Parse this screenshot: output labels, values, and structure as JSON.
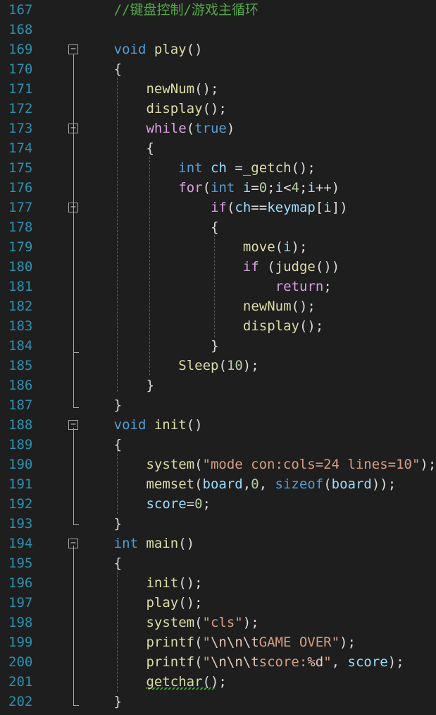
{
  "editor": {
    "language": "C",
    "colors": {
      "background": "#1e1e1e",
      "line_number": "#2b91af",
      "keyword": "#569cd6",
      "control": "#d8a0df",
      "function": "#dcdcaa",
      "variable": "#9cdcfe",
      "number": "#b5cea8",
      "string": "#d69d85",
      "escape": "#e8c9bb",
      "comment": "#57a64a",
      "text": "#dcdcdc"
    },
    "folding_icon": "minus-box-icon",
    "lines": [
      {
        "num": "167",
        "code": "        //键盘控制/游戏主循环"
      },
      {
        "num": "168",
        "code": ""
      },
      {
        "num": "169",
        "code": "        void play()"
      },
      {
        "num": "170",
        "code": "        {"
      },
      {
        "num": "171",
        "code": "            newNum();"
      },
      {
        "num": "172",
        "code": "            display();"
      },
      {
        "num": "173",
        "code": "            while(true)"
      },
      {
        "num": "174",
        "code": "            {"
      },
      {
        "num": "175",
        "code": "                int ch =_getch();"
      },
      {
        "num": "176",
        "code": "                for(int i=0;i<4;i++)"
      },
      {
        "num": "177",
        "code": "                    if(ch==keymap[i])"
      },
      {
        "num": "178",
        "code": "                    {"
      },
      {
        "num": "179",
        "code": "                        move(i);"
      },
      {
        "num": "180",
        "code": "                        if (judge())"
      },
      {
        "num": "181",
        "code": "                            return;"
      },
      {
        "num": "182",
        "code": "                        newNum();"
      },
      {
        "num": "183",
        "code": "                        display();"
      },
      {
        "num": "184",
        "code": "                    }"
      },
      {
        "num": "185",
        "code": "                Sleep(10);"
      },
      {
        "num": "186",
        "code": "            }"
      },
      {
        "num": "187",
        "code": "        }"
      },
      {
        "num": "188",
        "code": "        void init()"
      },
      {
        "num": "189",
        "code": "        {"
      },
      {
        "num": "190",
        "code": "            system(\"mode con:cols=24 lines=10\");"
      },
      {
        "num": "191",
        "code": "            memset(board,0, sizeof(board));"
      },
      {
        "num": "192",
        "code": "            score=0;"
      },
      {
        "num": "193",
        "code": "        }"
      },
      {
        "num": "194",
        "code": "        int main()"
      },
      {
        "num": "195",
        "code": "        {"
      },
      {
        "num": "196",
        "code": "            init();"
      },
      {
        "num": "197",
        "code": "            play();"
      },
      {
        "num": "198",
        "code": "            system(\"cls\");"
      },
      {
        "num": "199",
        "code": "            printf(\"\\n\\n\\tGAME OVER\");"
      },
      {
        "num": "200",
        "code": "            printf(\"\\n\\n\\tscore:%d\", score);"
      },
      {
        "num": "201",
        "code": "            getchar();"
      },
      {
        "num": "202",
        "code": "        }"
      }
    ]
  }
}
